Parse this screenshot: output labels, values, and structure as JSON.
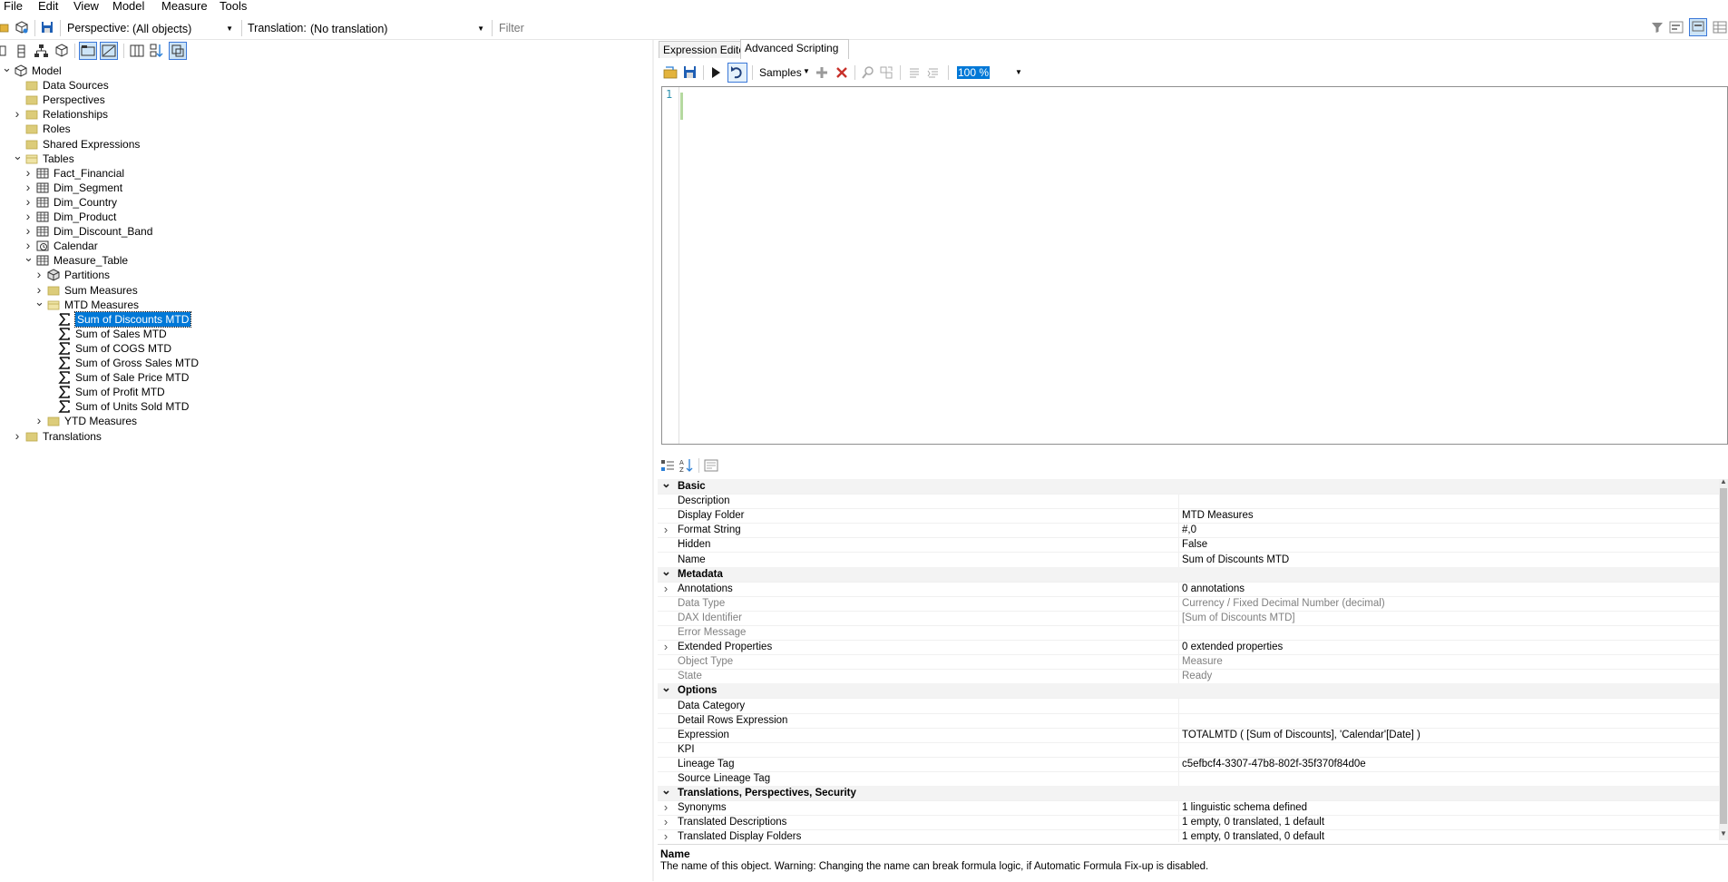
{
  "menu": [
    "File",
    "Edit",
    "View",
    "Model",
    "Measure",
    "Tools"
  ],
  "toolbar": {
    "perspective_label": "Perspective:",
    "perspective_value": "(All objects)",
    "translation_label": "Translation:",
    "translation_value": "(No translation)",
    "filter_placeholder": "Filter"
  },
  "tree": [
    {
      "label": "Model",
      "icon": "model-icon",
      "expander": "expanded"
    },
    {
      "label": "Data Sources",
      "icon": "folder-icon",
      "expander": "none"
    },
    {
      "label": "Perspectives",
      "icon": "folder-icon",
      "expander": "none"
    },
    {
      "label": "Relationships",
      "icon": "folder-icon",
      "expander": "collapsed"
    },
    {
      "label": "Roles",
      "icon": "folder-icon",
      "expander": "none"
    },
    {
      "label": "Shared Expressions",
      "icon": "folder-icon",
      "expander": "none"
    },
    {
      "label": "Tables",
      "icon": "folder-open-icon",
      "expander": "expanded"
    },
    {
      "label": "Fact_Financial",
      "icon": "table-icon",
      "expander": "collapsed"
    },
    {
      "label": "Dim_Segment",
      "icon": "table-icon",
      "expander": "collapsed"
    },
    {
      "label": "Dim_Country",
      "icon": "table-icon",
      "expander": "collapsed"
    },
    {
      "label": "Dim_Product",
      "icon": "table-icon",
      "expander": "collapsed"
    },
    {
      "label": "Dim_Discount_Band",
      "icon": "table-icon",
      "expander": "collapsed"
    },
    {
      "label": "Calendar",
      "icon": "calendar-icon",
      "expander": "collapsed"
    },
    {
      "label": "Measure_Table",
      "icon": "table-icon",
      "expander": "expanded"
    },
    {
      "label": "Partitions",
      "icon": "partitions-icon",
      "expander": "collapsed"
    },
    {
      "label": "Sum Measures",
      "icon": "folder-icon",
      "expander": "collapsed"
    },
    {
      "label": "MTD Measures",
      "icon": "folder-open-icon",
      "expander": "expanded"
    },
    {
      "label": "Sum of Discounts MTD",
      "icon": "sigma-icon",
      "expander": "none",
      "selected": true
    },
    {
      "label": "Sum of  Sales MTD",
      "icon": "sigma-icon",
      "expander": "none"
    },
    {
      "label": "Sum of COGS MTD",
      "icon": "sigma-icon",
      "expander": "none"
    },
    {
      "label": "Sum of Gross Sales MTD",
      "icon": "sigma-icon",
      "expander": "none"
    },
    {
      "label": "Sum of Sale Price MTD",
      "icon": "sigma-icon",
      "expander": "none"
    },
    {
      "label": "Sum of Profit MTD",
      "icon": "sigma-icon",
      "expander": "none"
    },
    {
      "label": "Sum of Units Sold MTD",
      "icon": "sigma-icon",
      "expander": "none"
    },
    {
      "label": "YTD Measures",
      "icon": "folder-icon",
      "expander": "collapsed"
    },
    {
      "label": "Translations",
      "icon": "folder-icon",
      "expander": "collapsed"
    }
  ],
  "tabs": [
    "Expression Editor",
    "Advanced Scripting"
  ],
  "editor": {
    "samples_label": "Samples",
    "zoom": "100 %",
    "line_number": "1"
  },
  "properties": [
    {
      "kind": "cat",
      "name": "Basic"
    },
    {
      "kind": "prop",
      "name": "Description",
      "value": ""
    },
    {
      "kind": "prop",
      "name": "Display Folder",
      "value": "MTD Measures"
    },
    {
      "kind": "prop",
      "name": "Format String",
      "value": "#,0",
      "expandable": true
    },
    {
      "kind": "prop",
      "name": "Hidden",
      "value": "False"
    },
    {
      "kind": "prop",
      "name": "Name",
      "value": "Sum of Discounts MTD"
    },
    {
      "kind": "cat",
      "name": "Metadata"
    },
    {
      "kind": "prop",
      "name": "Annotations",
      "value": "0 annotations",
      "expandable": true
    },
    {
      "kind": "prop",
      "name": "Data Type",
      "value": "Currency / Fixed Decimal Number (decimal)",
      "readonly": true
    },
    {
      "kind": "prop",
      "name": "DAX Identifier",
      "value": "[Sum of Discounts MTD]",
      "readonly": true
    },
    {
      "kind": "prop",
      "name": "Error Message",
      "value": "",
      "readonly": true
    },
    {
      "kind": "prop",
      "name": "Extended Properties",
      "value": "0 extended properties",
      "expandable": true
    },
    {
      "kind": "prop",
      "name": "Object Type",
      "value": "Measure",
      "readonly": true
    },
    {
      "kind": "prop",
      "name": "State",
      "value": "Ready",
      "readonly": true
    },
    {
      "kind": "cat",
      "name": "Options"
    },
    {
      "kind": "prop",
      "name": "Data Category",
      "value": ""
    },
    {
      "kind": "prop",
      "name": "Detail Rows Expression",
      "value": ""
    },
    {
      "kind": "prop",
      "name": "Expression",
      "value": "TOTALMTD ( [Sum of Discounts], 'Calendar'[Date] )"
    },
    {
      "kind": "prop",
      "name": "KPI",
      "value": ""
    },
    {
      "kind": "prop",
      "name": "Lineage Tag",
      "value": "c5efbcf4-3307-47b8-802f-35f370f84d0e"
    },
    {
      "kind": "prop",
      "name": "Source Lineage Tag",
      "value": ""
    },
    {
      "kind": "cat",
      "name": "Translations, Perspectives, Security"
    },
    {
      "kind": "prop",
      "name": "Synonyms",
      "value": "1 linguistic schema defined",
      "expandable": true
    },
    {
      "kind": "prop",
      "name": "Translated Descriptions",
      "value": "1 empty, 0 translated, 1 default",
      "expandable": true
    },
    {
      "kind": "prop",
      "name": "Translated Display Folders",
      "value": "1 empty, 0 translated, 0 default",
      "expandable": true
    }
  ],
  "description": {
    "title": "Name",
    "text": "The name of this object. Warning: Changing the name can break formula logic, if Automatic Formula Fix-up is disabled."
  },
  "colors": {
    "selection": "#0078d7",
    "folder": "#dccc7a",
    "run_green": "#1a1a1a",
    "delete_red": "#c8312a"
  }
}
